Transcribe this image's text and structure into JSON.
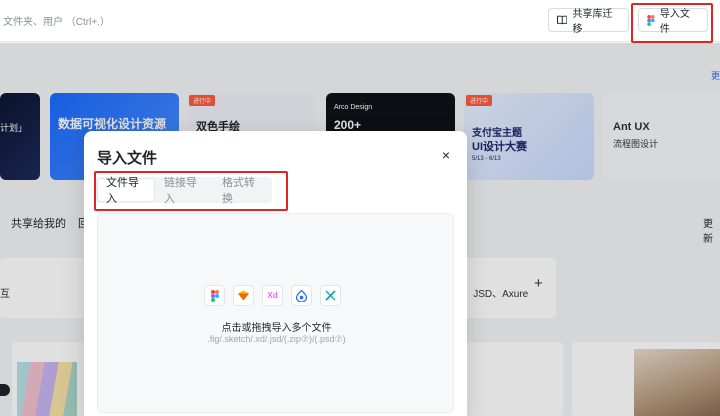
{
  "topbar": {
    "search_hint": "文件夹、用户 （Ctrl+.）",
    "migrate_label": "共享库迁移",
    "import_label": "导入文件"
  },
  "background": {
    "more_link": "更",
    "banners": [
      {
        "text": "计划」"
      },
      {
        "text": "数据可视化设计资源"
      },
      {
        "tag": "进行中",
        "text": "双色手绘"
      },
      {
        "logo": "Arco Design",
        "text": "200+"
      },
      {
        "tag": "进行中",
        "line1": "支付宝主题",
        "line2": "UI设计大赛",
        "dates": "5/13 - 6/13"
      },
      {
        "line1": "Ant UX",
        "line2": "流程图设计"
      }
    ],
    "shared_tab": "共享给我的",
    "shared_more": "回",
    "update_label": "更新",
    "panel_left_text": "互",
    "panel_right_text": "D、JSD、Axure",
    "panel_right_plus": "+"
  },
  "modal": {
    "title": "导入文件",
    "close": "×",
    "tabs": [
      {
        "label": "文件导入",
        "active": true
      },
      {
        "label": "链接导入",
        "active": false
      },
      {
        "label": "格式转换",
        "active": false
      }
    ],
    "formats": [
      {
        "icon": "figma-icon",
        "glyph": "F",
        "color": "#f24e1e"
      },
      {
        "icon": "sketch-icon",
        "glyph": "◆",
        "color": "#f7b500"
      },
      {
        "icon": "xd-icon",
        "glyph": "Xd",
        "color": "#ff61f6"
      },
      {
        "icon": "jsd-icon",
        "glyph": "◎",
        "color": "#1f6bff"
      },
      {
        "icon": "axure-icon",
        "glyph": "✕",
        "color": "#2fb3e6"
      }
    ],
    "drop_text": "点击或拖拽导入多个文件",
    "drop_sub": ".fig/.sketch/.xd/.jsd/(.zip⑦)/(.psd⑦)"
  }
}
